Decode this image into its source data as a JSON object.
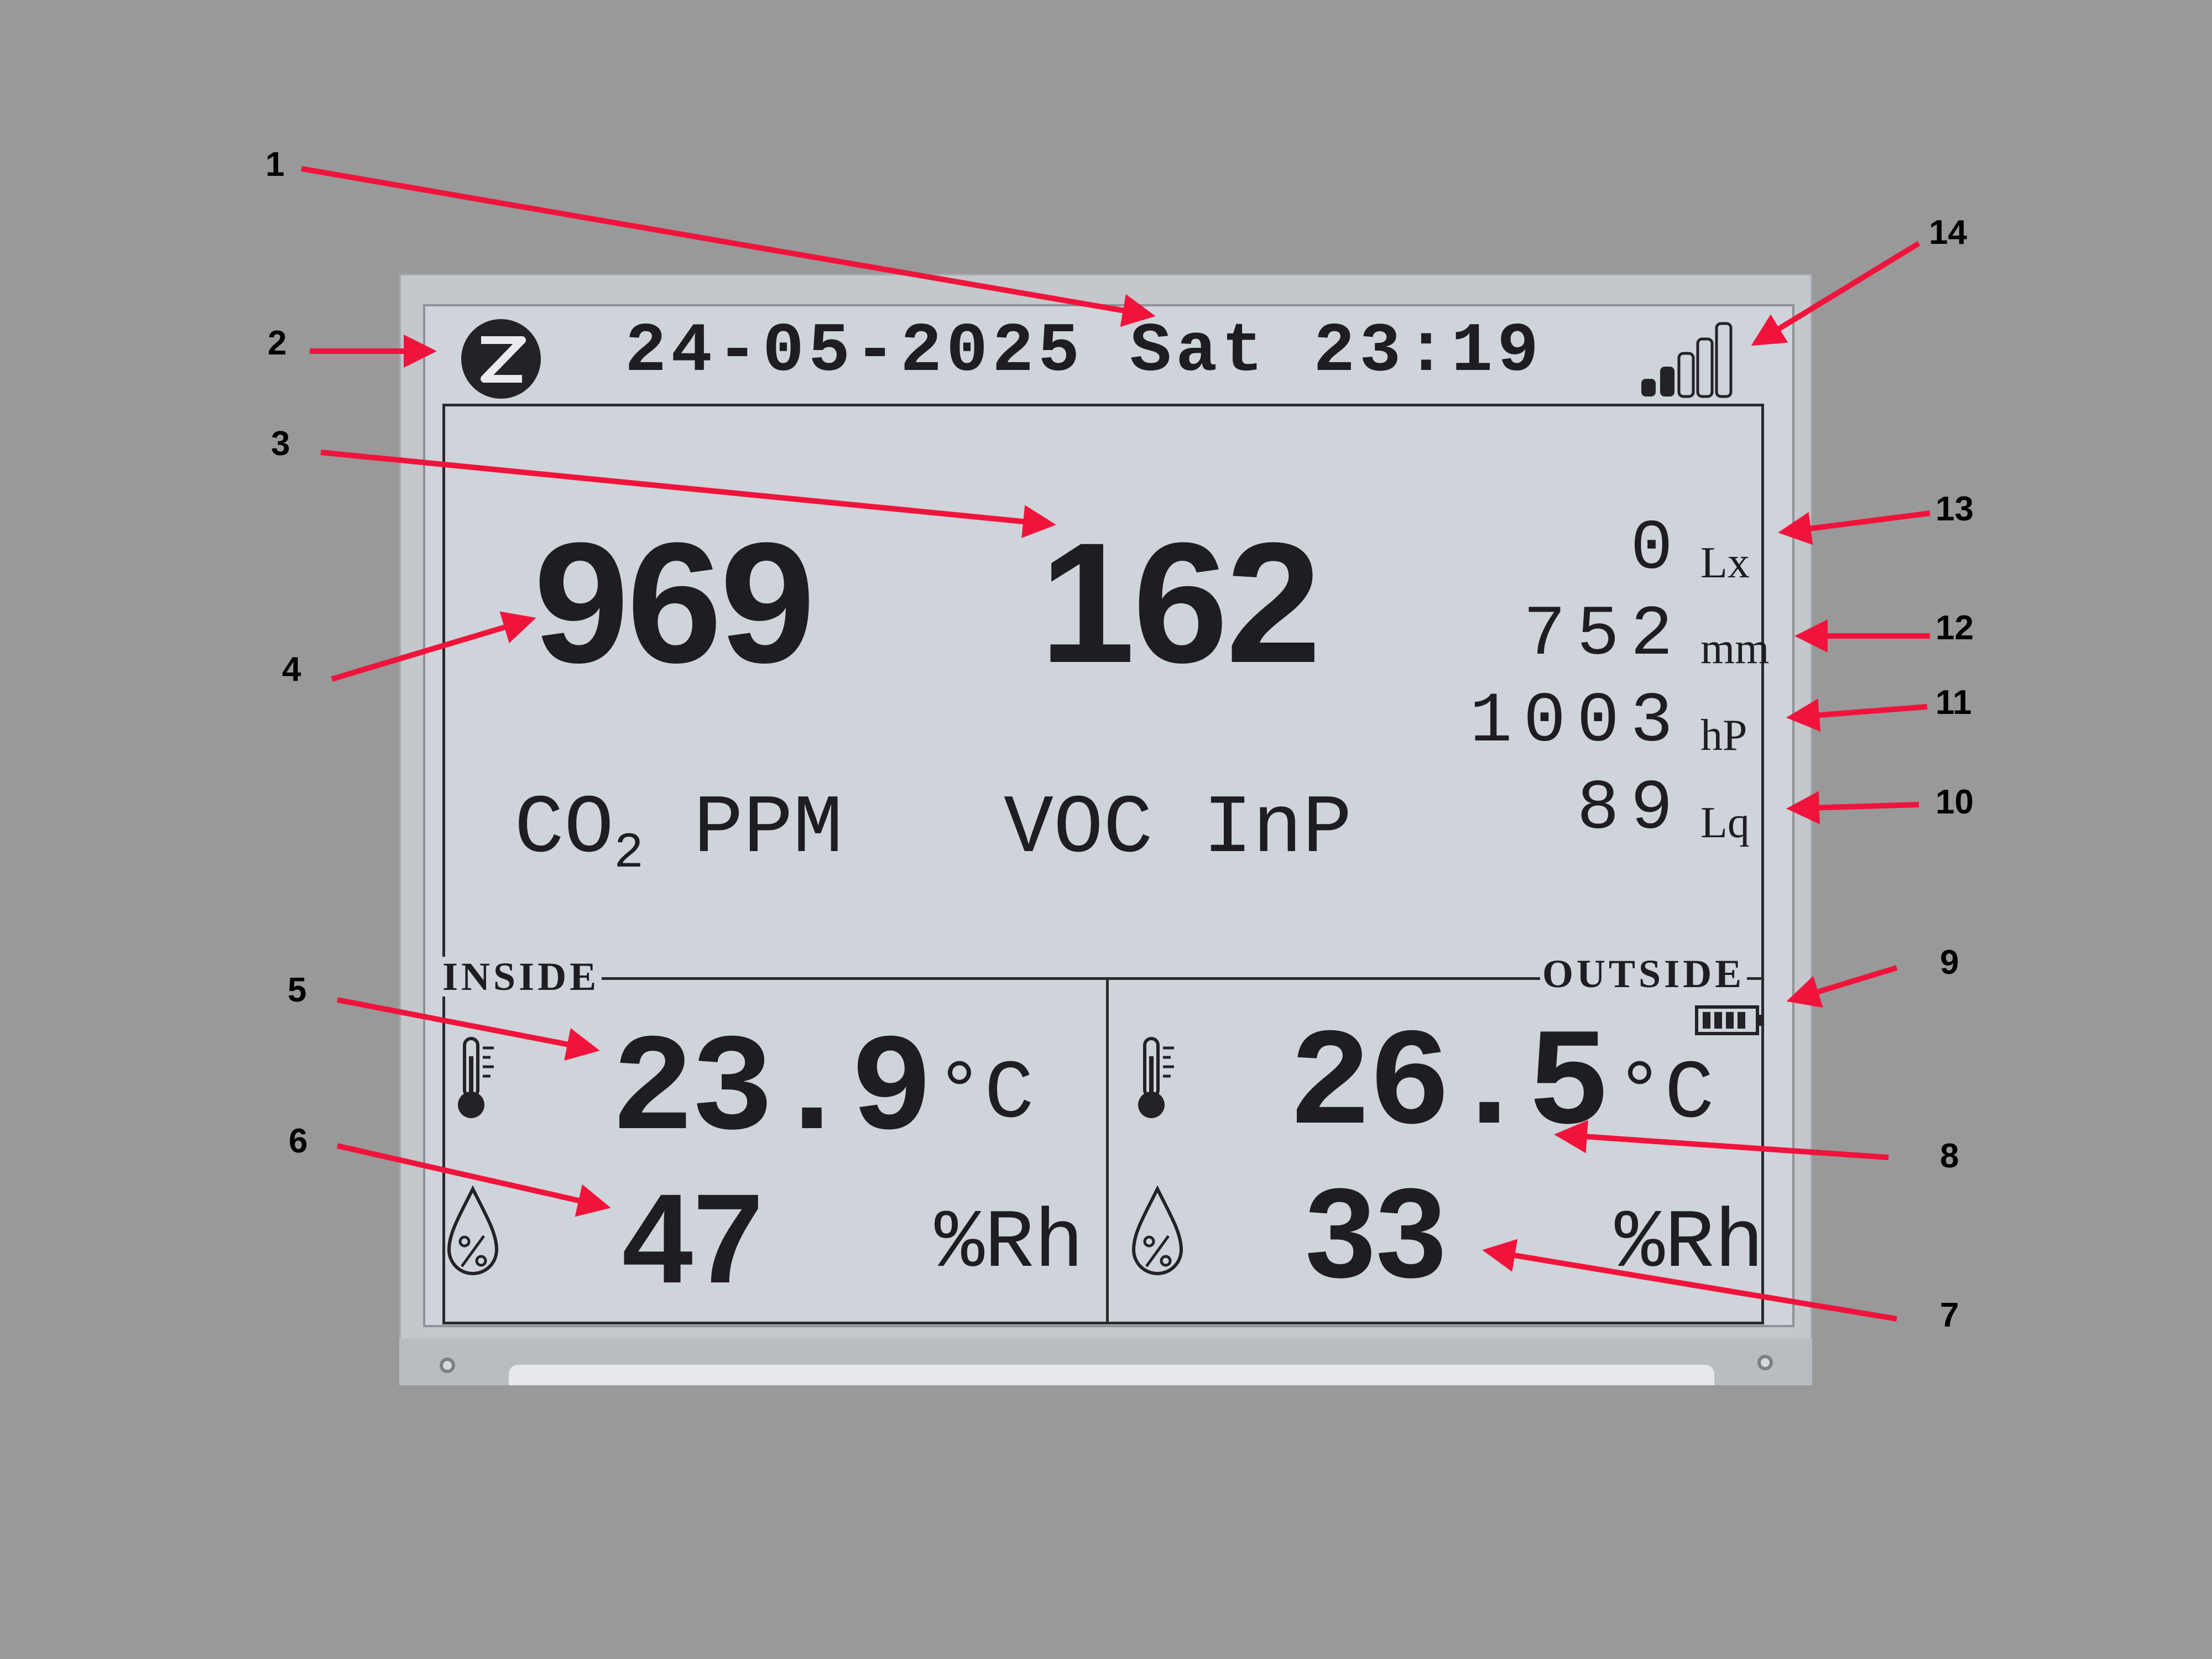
{
  "header": {
    "datetime": "24-05-2025 Sat 23:19"
  },
  "air_quality": {
    "co2_value": "969",
    "voc_value": "162",
    "co2_label": "CO",
    "co2_label_sub": "2",
    "co2_label_unit": "PPM",
    "voc_label": "VOC InP"
  },
  "sensors": [
    {
      "value": "0",
      "unit": "Lx"
    },
    {
      "value": "752",
      "unit": "mm"
    },
    {
      "value": "1003",
      "unit": "hP"
    },
    {
      "value": "89",
      "unit": "Lq"
    }
  ],
  "inside": {
    "label": "INSIDE",
    "temperature": "23.9",
    "temp_unit": "°C",
    "humidity": "47",
    "humidity_unit": "%Rh"
  },
  "outside": {
    "label": "OUTSIDE",
    "temperature": "26.5",
    "temp_unit": "°C",
    "humidity": "33",
    "humidity_unit": "%Rh"
  },
  "signal_level": 0.4,
  "battery_level": 1.0,
  "annotations": [
    "1",
    "2",
    "3",
    "4",
    "5",
    "6",
    "7",
    "8",
    "9",
    "10",
    "11",
    "12",
    "13",
    "14"
  ],
  "colors": {
    "background": "#999999",
    "screen": "#cfd3da",
    "ink": "#1e1d22",
    "arrow": "#f0143c"
  }
}
